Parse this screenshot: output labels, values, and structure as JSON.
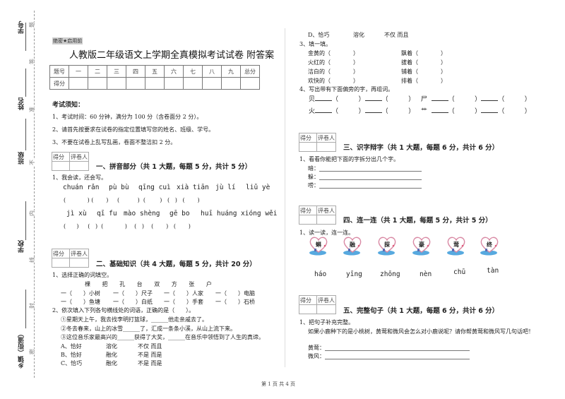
{
  "side": {
    "labels": [
      "学号",
      "姓名",
      "班级",
      "学校",
      "乡镇（街道）"
    ],
    "seal_chars": [
      "题",
      "答",
      "准",
      "不",
      "内",
      "线",
      "封",
      "密"
    ]
  },
  "header": {
    "secret_tag": "绝密★启用前",
    "title": "人教版二年级语文上学期全真模拟考试试卷 附答案"
  },
  "score_table": {
    "header": [
      "题号",
      "一",
      "二",
      "三",
      "四",
      "五",
      "六",
      "七",
      "八",
      "九",
      "总分"
    ],
    "row_label": "得分"
  },
  "notice": {
    "heading": "考试须知：",
    "items": [
      "1、考试时间：60 分钟，满分为 100 分（含卷面分 2 分）。",
      "2、请首先按要求在试卷的指定位置填写您的姓名、班级、学号。",
      "3、不要在试卷上乱写乱画，卷面不整洁扣 2 分。"
    ]
  },
  "grader": {
    "score": "得分",
    "reviewer": "评卷人"
  },
  "sections": {
    "s1": {
      "title": "一、拼音部分（共 1 大题，每题 5 分，共计 5 分）",
      "q1": "1、我会读，还会写。",
      "pinyin_row1": [
        "chuán rǎn",
        "pù bù",
        "qīng cuì",
        "xià tiān",
        "jù lí",
        "liǔ yè"
      ],
      "pinyin_row2": [
        "jì xù",
        "qī fu",
        "mào shèng",
        "gē bo",
        "huī huáng",
        "xióng wěi"
      ]
    },
    "s2": {
      "title": "二、基础知识（共 4 大题，每题 5 分，共计 20 分）",
      "q1": "1、选择正确的词填空。",
      "word_bank": [
        "棵",
        "把",
        "孔",
        "台",
        "双",
        "方",
        "张",
        "户"
      ],
      "fill_row1": [
        "一（　　）小树",
        "一（　　）尺子",
        "一（　　）人家",
        "一（　　）电脑"
      ],
      "fill_row2": [
        "一（　　）鱼塘",
        "一（　　）白纸",
        "一（　　）手套",
        "一（　　）石桥"
      ],
      "q2": "2、依次填入下列各句横线处的词语，正确的是（　　）。",
      "sentences": [
        "①星期天上午，我去找李明打篮球，______他走亲戚去了。",
        "②冬去春来，山上的冰雪______了，汇成一条条小溪，从山上流下来。",
        "③这位音乐家最高兴的______获得了大奖，______在音乐中领悟到了人生的真谛。"
      ],
      "options": [
        [
          "A、恰好",
          "溶化",
          "不仅 而且"
        ],
        [
          "B、恰好",
          "融化",
          "不是 而是"
        ],
        [
          "C、恰巧",
          "融化",
          "不是 而是"
        ],
        [
          "D、恰巧",
          "溶化",
          "不仅 而且"
        ]
      ],
      "q3": "3、填一填。",
      "fill3_left": [
        "金黄的（　　　　）",
        "火红的（　　　　）",
        "洁白的（　　　　）",
        "欢快的（　　　　）"
      ],
      "fill3_right": [
        "飘着（　　　　）",
        "拔着（　　　　）",
        "铺着（　　　　）",
        "排着（　　　　）"
      ],
      "q4": "4、写出带有下面偏旁的字，再组词。",
      "radicals": [
        "贝",
        "尸",
        "火",
        "艹"
      ]
    },
    "s3": {
      "title": "三、识字辩字（共 1 大题，每题 6 分，共计 6 分）",
      "q1": "1、看看你能把下面的字拆分出几个字。",
      "chars": [
        "暗：",
        "躲：",
        "唠："
      ]
    },
    "s4": {
      "title": "四、连一连（共 1 大题，每题 5 分，共计 5 分）",
      "q1": "1、读一读，连一连。",
      "heart_chars": [
        "蝌",
        "融",
        "探",
        "豪",
        "莺",
        "终"
      ],
      "pinyin": [
        "háo",
        "yīng",
        "zhōng",
        "nèn",
        "chū",
        "tàn"
      ]
    },
    "s5": {
      "title": "五、完整句子（共 1 大题，每题 6 分，共计 6 分）",
      "q1": "1、把句子补充完整。",
      "prompt": "如果小鹿种下的是小桃树，黄莺和微风会怎么对小鹿说呢？请你帮黄莺和微风写几句话吧！",
      "lines": [
        "黄莺：",
        "微风："
      ]
    }
  },
  "footer": {
    "page": "第 1 页 共 4 页"
  },
  "colors": {
    "heart_stroke": "#d98aa5",
    "water": "#3a9ad9"
  }
}
